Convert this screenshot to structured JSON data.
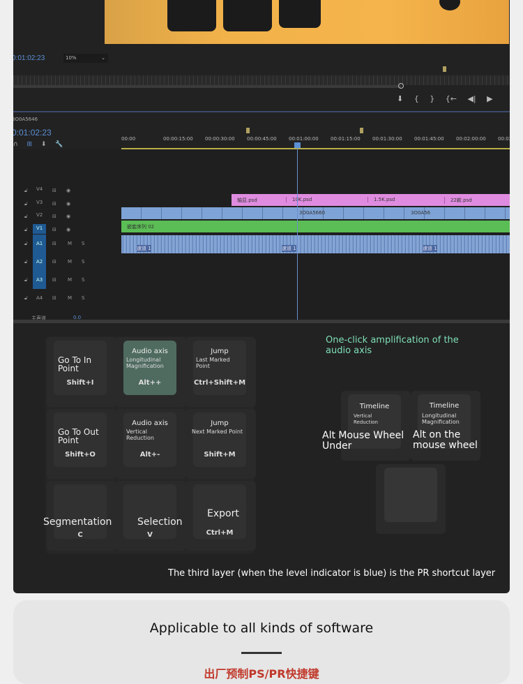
{
  "program_monitor": {
    "timecode": "0:01:02:23",
    "zoom": "10%"
  },
  "sequence": {
    "name": "3O0A5646",
    "timecode": "0:01:02:23",
    "ruler": [
      "00:00",
      "00:00:15:00",
      "00:00:30:00",
      "00:00:45:00",
      "00:01:00:00",
      "00:01:15:00",
      "00:01:30:00",
      "00:01:45:00",
      "00:02:00:00",
      "00:02:15:00"
    ],
    "video_tracks": [
      "V4",
      "V3",
      "V2",
      "V1"
    ],
    "audio_tracks": [
      "A1",
      "A2",
      "A3",
      "A4"
    ],
    "master_label": "主声道",
    "master_value": "0.0",
    "v3_clips": [
      "轴显.psd",
      "10K.psd",
      "1.5K.psd",
      "22款.psd"
    ],
    "v2_clips": [
      "3O0A5660",
      "3O0A56"
    ],
    "v1_clip": "嵌套序列 02",
    "a1_clips": [
      "速道 1",
      "速道 1",
      "速道 1"
    ]
  },
  "keys": [
    {
      "title": "Go To In Point",
      "shortcut": "Shift+I"
    },
    {
      "title": "Audio axis",
      "sub": "Longitudinal Magnification",
      "shortcut": "Alt++"
    },
    {
      "title": "Jump",
      "sub": "Last Marked Point",
      "shortcut": "Ctrl+Shift+M"
    },
    {
      "title": "Go To Out Point",
      "shortcut": "Shift+O"
    },
    {
      "title": "Audio axis",
      "sub": "Vertical Reduction",
      "shortcut": "Alt+-"
    },
    {
      "title": "Jump",
      "sub": "Next Marked Point",
      "shortcut": "Shift+M"
    },
    {
      "title": "Segmentation",
      "shortcut": "C"
    },
    {
      "title": "Selection",
      "shortcut": "V"
    },
    {
      "title": "Export",
      "shortcut": "Ctrl+M"
    }
  ],
  "annotation": "One-click amplification of the audio axis",
  "wheel": [
    {
      "title": "Timeline",
      "sub": "Vertical Reduction",
      "label": "Alt Mouse Wheel Under"
    },
    {
      "title": "Timeline",
      "sub": "Longitudinal Magnification",
      "label": "Alt on the mouse wheel"
    }
  ],
  "caption": "The third layer (when the level indicator is blue) is the PR shortcut layer",
  "section_title": "Applicable to all kinds of software",
  "section_subtitle": "出厂预制PS/PR快捷键",
  "colors": {
    "accent_green": "#7fe0b8",
    "highlight_key": "#4f6b60",
    "subtitle_red": "#c0392b"
  }
}
